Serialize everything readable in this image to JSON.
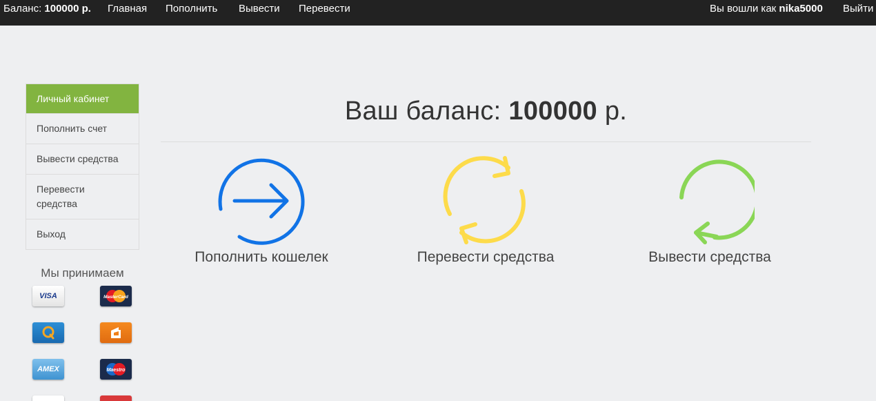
{
  "navbar": {
    "balance_prefix": "Баланс:",
    "balance_value": "100000 р.",
    "links": [
      "Главная",
      "Пополнить",
      "Вывести",
      "Перевести"
    ],
    "logged_in_prefix": "Вы вошли как",
    "username": "nika5000",
    "logout": "Выйти"
  },
  "sidebar": {
    "items": [
      "Личный кабинет",
      "Пополнить счет",
      "Вывести средства",
      "Перевести средства",
      "Выход"
    ],
    "accept_title": "Мы принимаем",
    "cards": [
      "VISA",
      "MasterCard",
      "QIWI",
      "Яндекс.Деньги",
      "AMEX",
      "Maestro",
      "card",
      "card"
    ]
  },
  "main": {
    "balance_prefix": "Ваш баланс:",
    "balance_value": "100000",
    "balance_unit": "р.",
    "actions": [
      {
        "label": "Пополнить кошелек",
        "icon": "arrow-right-circle-icon",
        "color": "#1173e6"
      },
      {
        "label": "Перевести средства",
        "icon": "refresh-cycle-icon",
        "color": "#fddb4a"
      },
      {
        "label": "Вывести средства",
        "icon": "circular-arrow-icon",
        "color": "#8ad656"
      }
    ]
  },
  "colors": {
    "navbar_bg": "#222222",
    "active_green": "#82b440",
    "page_bg": "#eeeff1"
  }
}
